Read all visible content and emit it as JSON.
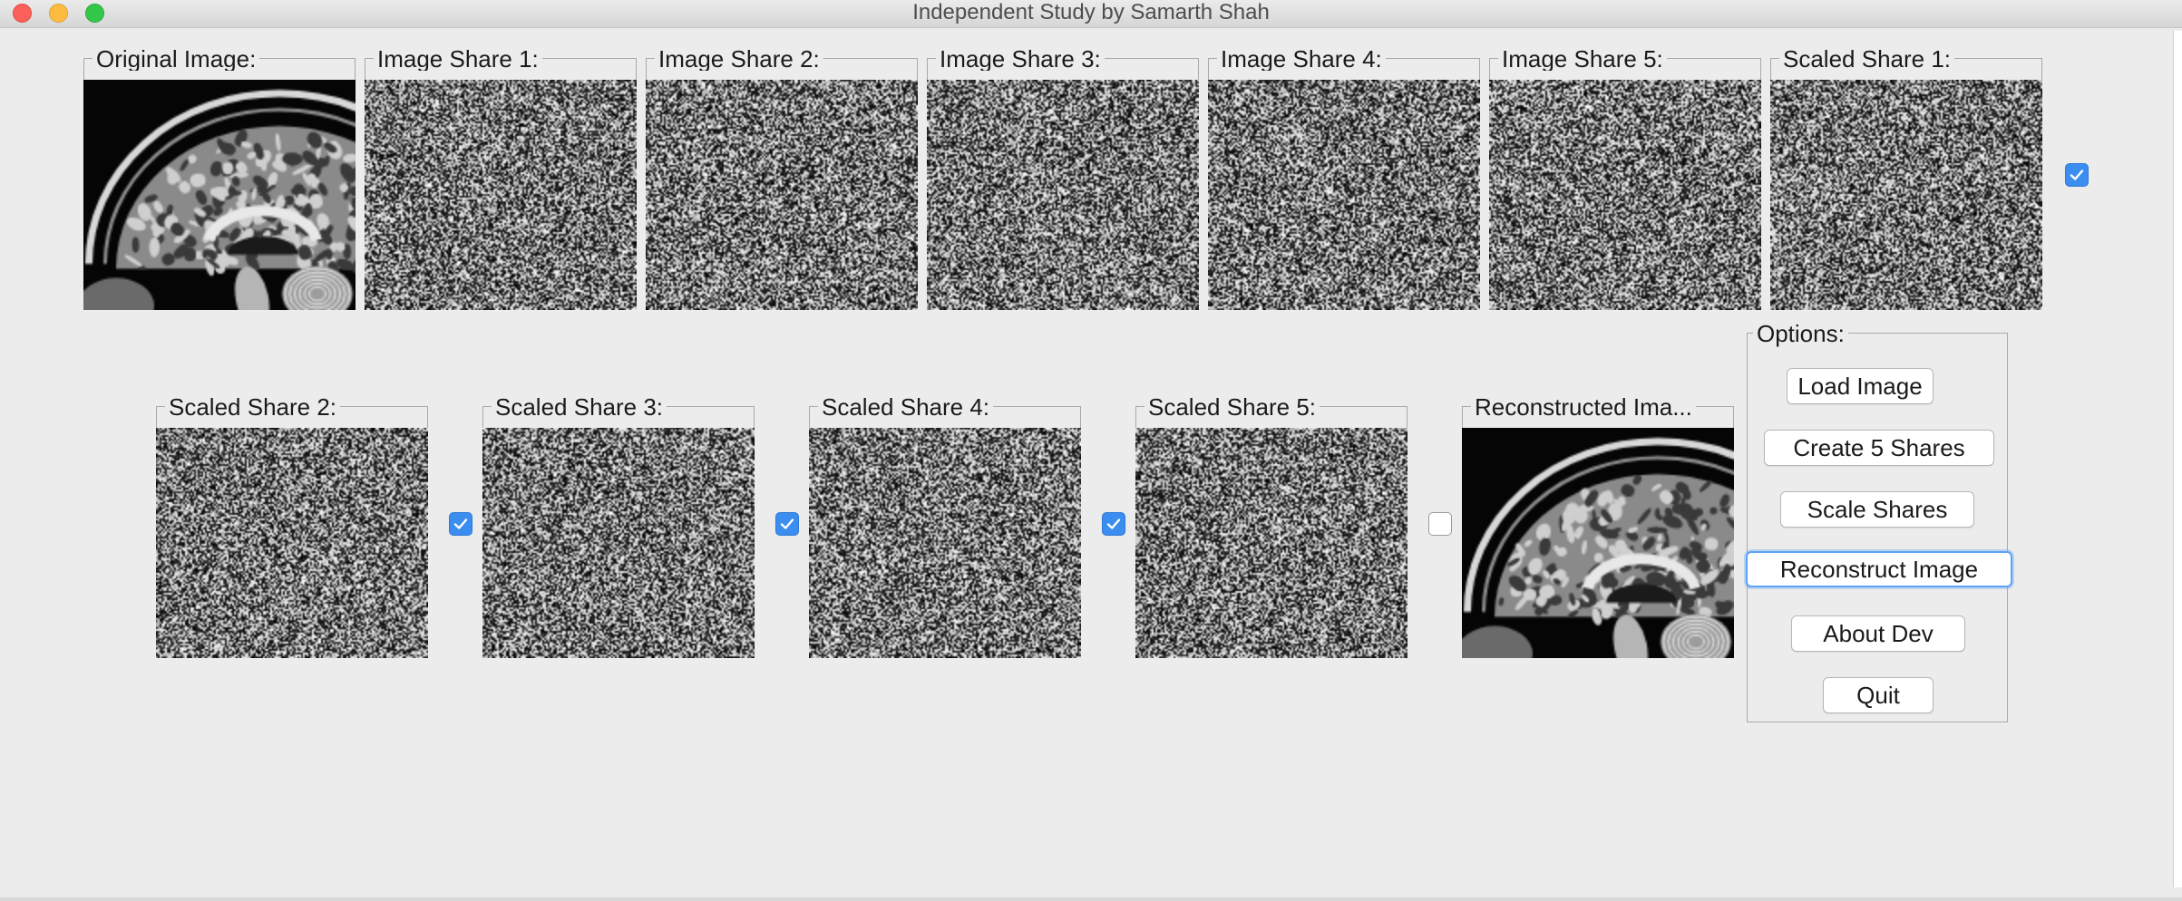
{
  "window": {
    "title": "Independent Study by Samarth Shah",
    "controls": [
      "close-icon",
      "minimize-icon",
      "maximize-icon"
    ]
  },
  "row1": [
    {
      "label": "Original Image:",
      "content": "brain-mri-sagittal"
    },
    {
      "label": "Image Share 1:",
      "content": "noise"
    },
    {
      "label": "Image Share 2:",
      "content": "noise"
    },
    {
      "label": "Image Share 3:",
      "content": "noise"
    },
    {
      "label": "Image Share 4:",
      "content": "noise"
    },
    {
      "label": "Image Share 5:",
      "content": "noise"
    },
    {
      "label": "Scaled Share 1:",
      "content": "noise"
    }
  ],
  "row2": [
    {
      "label": "Scaled Share 2:",
      "content": "noise"
    },
    {
      "label": "Scaled Share 3:",
      "content": "noise"
    },
    {
      "label": "Scaled Share 4:",
      "content": "noise"
    },
    {
      "label": "Scaled Share 5:",
      "content": "noise"
    },
    {
      "label": "Reconstructed Ima...",
      "content": "brain-mri-sagittal"
    }
  ],
  "share_checkboxes": [
    {
      "share": "Scaled Share 1",
      "checked": true
    },
    {
      "share": "Scaled Share 2",
      "checked": true
    },
    {
      "share": "Scaled Share 3",
      "checked": true
    },
    {
      "share": "Scaled Share 4",
      "checked": true
    },
    {
      "share": "Scaled Share 5",
      "checked": false
    }
  ],
  "options": {
    "title": "Options:",
    "buttons": {
      "load": "Load Image",
      "create": "Create 5 Shares",
      "scale": "Scale Shares",
      "reconstruct": "Reconstruct Image",
      "about": "About Dev",
      "quit": "Quit"
    },
    "focused_button": "Reconstruct Image"
  },
  "colors": {
    "background": "#ececec",
    "checkbox_checked": "#3b8df0",
    "focus_ring": "#5ea3f5"
  }
}
